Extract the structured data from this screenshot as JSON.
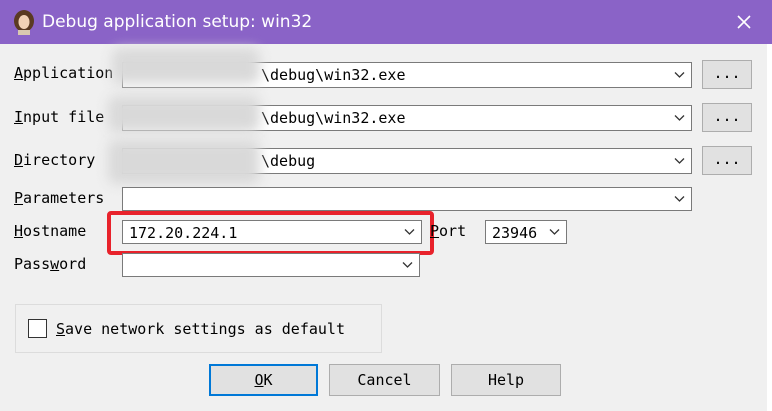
{
  "window": {
    "title": "Debug application setup: win32"
  },
  "fields": {
    "application": {
      "label_pre": "",
      "label_key": "A",
      "label_post": "pplication",
      "value": "\\debug\\win32.exe",
      "browse_label": "..."
    },
    "input_file": {
      "label_pre": "",
      "label_key": "I",
      "label_post": "nput file",
      "value": "\\debug\\win32.exe",
      "browse_label": "..."
    },
    "directory": {
      "label_pre": "",
      "label_key": "D",
      "label_post": "irectory",
      "value": "\\debug",
      "browse_label": "..."
    },
    "parameters": {
      "label_pre": "",
      "label_key": "P",
      "label_post": "arameters",
      "value": ""
    },
    "hostname": {
      "label_pre": "",
      "label_key": "H",
      "label_post": "ostname",
      "value": "172.20.224.1"
    },
    "port": {
      "label_pre": "",
      "label_key": "P",
      "label_post": "ort",
      "value": "23946"
    },
    "password": {
      "label_pre": "Pass",
      "label_key": "w",
      "label_post": "ord",
      "value": ""
    }
  },
  "save_settings": {
    "label_key": "S",
    "label_post": "ave network settings as default",
    "checked": false
  },
  "buttons": {
    "ok": {
      "key": "O",
      "rest": "K"
    },
    "cancel": "Cancel",
    "help": "Help"
  },
  "colors": {
    "titlebar": "#8a63c7",
    "highlight": "#e8222b",
    "default_button_border": "#0078d7"
  }
}
